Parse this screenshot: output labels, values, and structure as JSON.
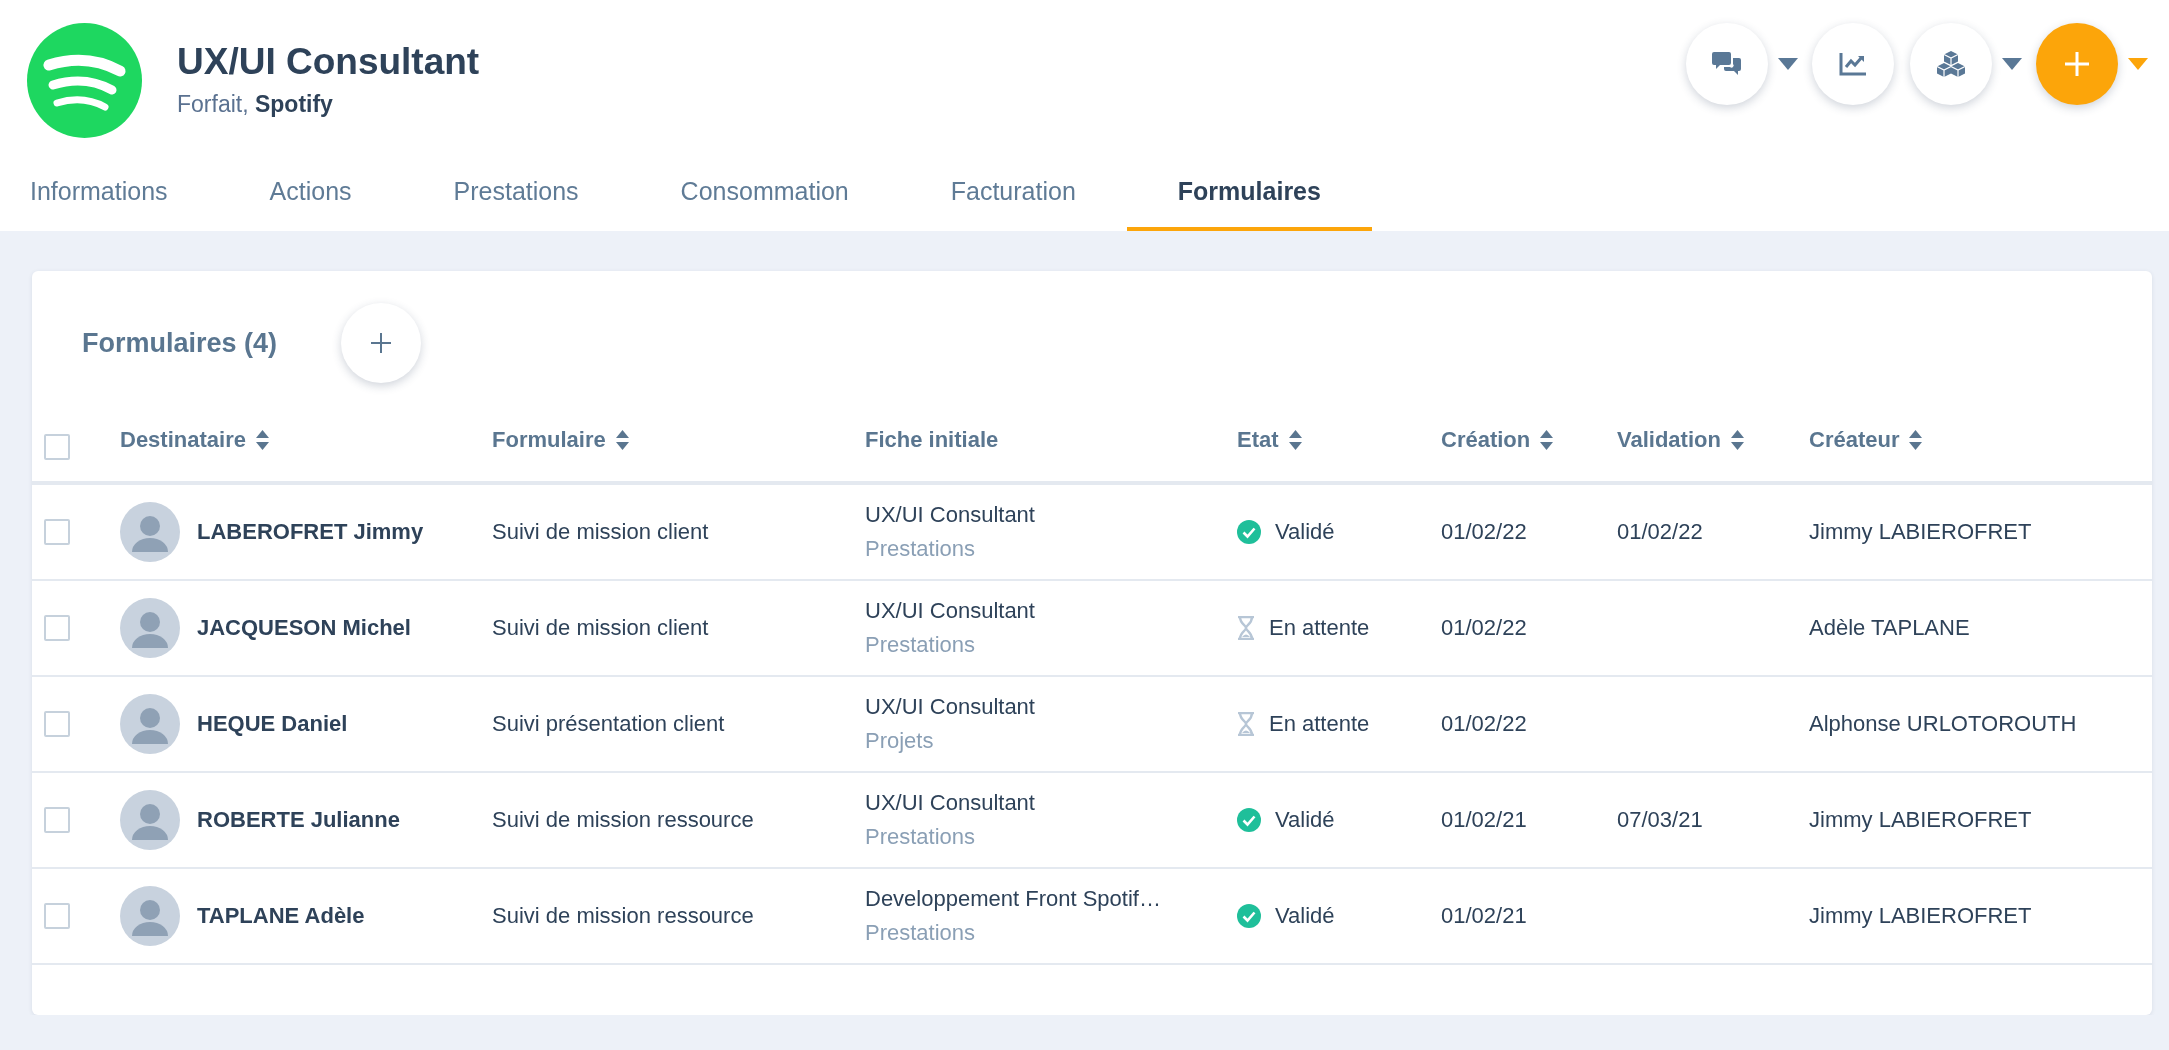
{
  "header": {
    "title": "UX/UI Consultant",
    "subtitle": "Forfait, **Spotify**"
  },
  "toolbar": [
    {
      "kind": "chat",
      "dropdown": true
    },
    {
      "kind": "chart",
      "dropdown": false
    },
    {
      "kind": "cubes",
      "dropdown": true
    },
    {
      "kind": "add",
      "dropdown": true
    }
  ],
  "tabs": [
    {
      "label": "Informations",
      "selected": false
    },
    {
      "label": "Actions",
      "selected": false
    },
    {
      "label": "Prestations",
      "selected": false
    },
    {
      "label": "Consommation",
      "selected": false
    },
    {
      "label": "Facturation",
      "selected": false
    },
    {
      "label": "Formulaires",
      "selected": true
    }
  ],
  "card": {
    "title": "Formulaires (4)"
  },
  "table": {
    "select_all_checked": false,
    "columns": [
      {
        "label": "Destinataire",
        "sortable": true
      },
      {
        "label": "Formulaire",
        "sortable": true
      },
      {
        "label": "Fiche initiale",
        "sortable": false
      },
      {
        "label": "Etat",
        "sortable": true
      },
      {
        "label": "Création",
        "sortable": true
      },
      {
        "label": "Validation",
        "sortable": true
      },
      {
        "label": "Créateur",
        "sortable": true
      }
    ],
    "rows": [
      {
        "checked": false,
        "recipient": "LABEROFRET Jimmy",
        "form": "Suivi de mission client",
        "record": "UX/UI Consultant",
        "record_section": "Prestations",
        "status": {
          "kind": "validated",
          "label": "Validé"
        },
        "created": "01/02/22",
        "validated": "01/02/22",
        "creator": "Jimmy LABIEROFRET"
      },
      {
        "checked": false,
        "recipient": "JACQUESON Michel",
        "form": "Suivi de mission client",
        "record": "UX/UI Consultant",
        "record_section": "Prestations",
        "status": {
          "kind": "pending",
          "label": "En attente"
        },
        "created": "01/02/22",
        "creator": "Adèle TAPLANE"
      },
      {
        "checked": false,
        "recipient": "HEQUE Daniel",
        "form": "Suivi présentation client",
        "record": "UX/UI Consultant",
        "record_section": "Projets",
        "status": {
          "kind": "pending",
          "label": "En attente"
        },
        "created": "01/02/22",
        "creator": "Alphonse URLOTOROUTH"
      },
      {
        "checked": false,
        "recipient": "ROBERTE Julianne",
        "form": "Suivi de mission ressource",
        "record": "UX/UI Consultant",
        "record_section": "Prestations",
        "status": {
          "kind": "validated",
          "label": "Validé"
        },
        "created": "01/02/21",
        "validated": "07/03/21",
        "creator": "Jimmy LABIEROFRET"
      },
      {
        "checked": false,
        "recipient": "TAPLANE Adèle",
        "form": "Suivi de mission ressource",
        "record": "Developpement Front Spotif…",
        "record_section": "Prestations",
        "status": {
          "kind": "validated",
          "label": "Validé"
        },
        "created": "01/02/21",
        "creator": "Jimmy LABIEROFRET"
      }
    ]
  }
}
